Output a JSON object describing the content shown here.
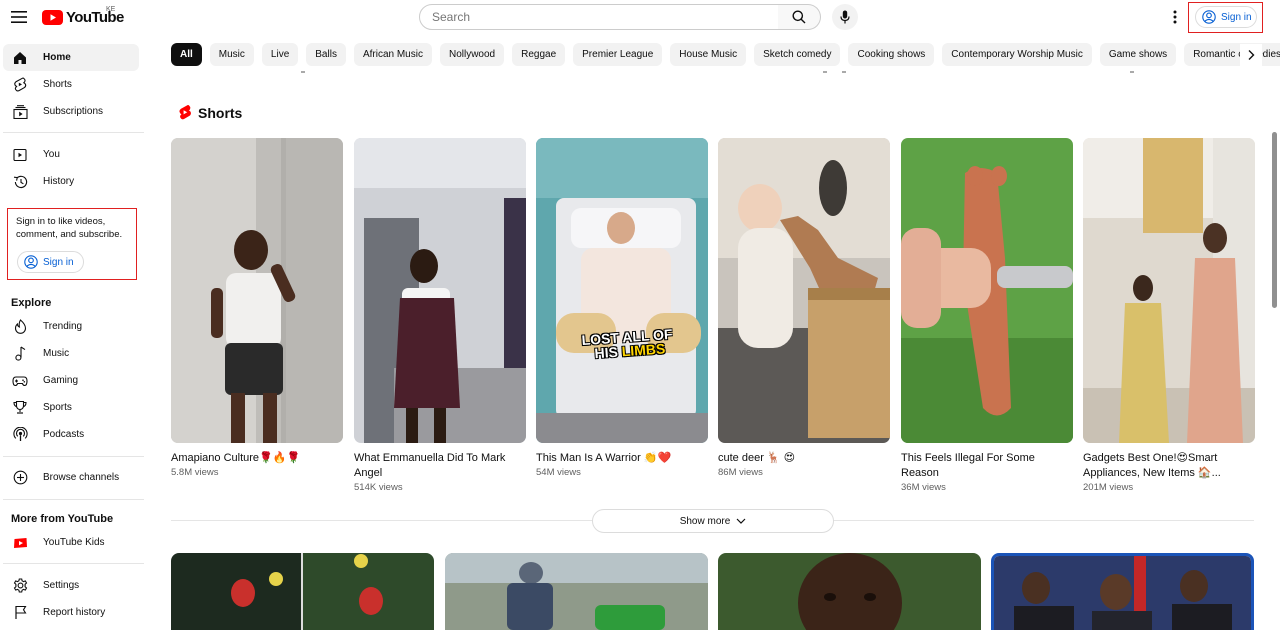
{
  "header": {
    "logo_text": "YouTube",
    "region": "KE",
    "search_placeholder": "Search",
    "signin_label": "Sign in"
  },
  "sidebar": {
    "primary": [
      {
        "label": "Home",
        "icon": "home-icon"
      },
      {
        "label": "Shorts",
        "icon": "shorts-icon"
      },
      {
        "label": "Subscriptions",
        "icon": "subscriptions-icon"
      }
    ],
    "you": [
      {
        "label": "You",
        "icon": "you-icon"
      },
      {
        "label": "History",
        "icon": "history-icon"
      }
    ],
    "signin_prompt": "Sign in to like videos, comment, and subscribe.",
    "signin_label": "Sign in",
    "explore_title": "Explore",
    "explore": [
      {
        "label": "Trending",
        "icon": "trending-icon"
      },
      {
        "label": "Music",
        "icon": "music-icon"
      },
      {
        "label": "Gaming",
        "icon": "gaming-icon"
      },
      {
        "label": "Sports",
        "icon": "sports-icon"
      },
      {
        "label": "Podcasts",
        "icon": "podcasts-icon"
      }
    ],
    "browse_channels": "Browse channels",
    "more_title": "More from YouTube",
    "youtube_kids": "YouTube Kids",
    "settings": "Settings",
    "report_history": "Report history"
  },
  "chips": [
    "All",
    "Music",
    "Live",
    "Balls",
    "African Music",
    "Nollywood",
    "Reggae",
    "Premier League",
    "House Music",
    "Sketch comedy",
    "Cooking shows",
    "Contemporary Worship Music",
    "Game shows",
    "Romantic comedies"
  ],
  "shorts": {
    "title": "Shorts",
    "items": [
      {
        "title": "Amapiano Culture🌹🔥🌹",
        "views": "5.8M views"
      },
      {
        "title": "What Emmanuella Did To Mark Angel",
        "views": "514K views"
      },
      {
        "title": "This Man Is A Warrior 👏❤️",
        "views": "54M views",
        "caption_line1": "LOST ALL OF",
        "caption_line2_a": "HIS ",
        "caption_line2_b": "LIMBS"
      },
      {
        "title": "cute deer 🦌 😍",
        "views": "86M views"
      },
      {
        "title": "This Feels Illegal For Some Reason",
        "views": "36M views"
      },
      {
        "title": "Gadgets Best One!😍Smart Appliances, New Items 🏠...",
        "views": "201M views"
      }
    ]
  },
  "show_more": "Show more",
  "colors": {
    "brand_red": "#ff0000",
    "link_blue": "#065fd4",
    "annotation_red": "#e02020"
  }
}
